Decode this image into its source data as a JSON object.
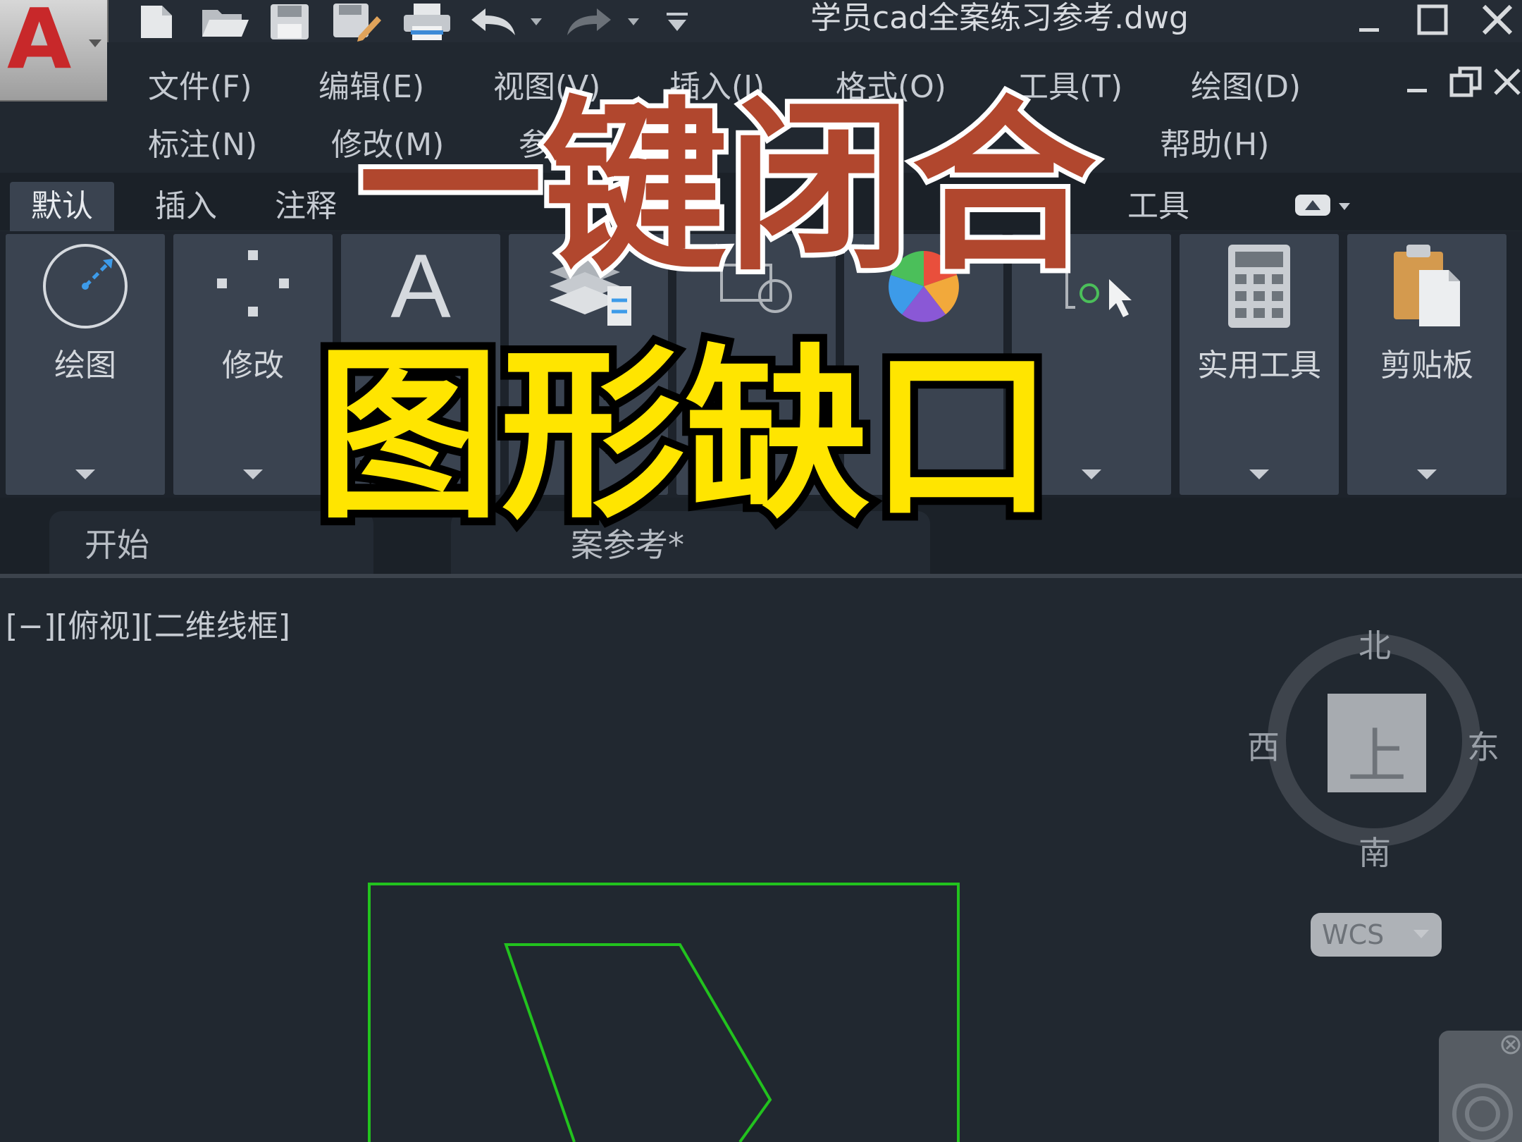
{
  "app": {
    "logo_letter": "A",
    "document_title": "学员cad全案练习参考.dwg"
  },
  "quick_access": [
    {
      "icon": "new-file-icon"
    },
    {
      "icon": "open-folder-icon"
    },
    {
      "icon": "save-icon"
    },
    {
      "icon": "save-as-icon"
    },
    {
      "icon": "print-icon"
    },
    {
      "icon": "undo-icon"
    },
    {
      "icon": "redo-icon"
    },
    {
      "icon": "customize-toolbar-icon"
    }
  ],
  "menu": {
    "row1": [
      "文件(F)",
      "编辑(E)",
      "视图(V)",
      "插入(I)",
      "格式(O)",
      "工具(T)",
      "绘图(D)"
    ],
    "row2": [
      "标注(N)",
      "修改(M)",
      "参",
      "帮助(H)"
    ]
  },
  "ribbon_tabs": [
    "默认",
    "插入",
    "注释",
    "工具"
  ],
  "ribbon_panels": [
    {
      "label": "绘图",
      "icon": "circle-draw-icon"
    },
    {
      "label": "修改",
      "icon": "modify-dots-icon"
    },
    {
      "label": "",
      "icon": "text-icon",
      "glyph": "A"
    },
    {
      "label": "",
      "icon": "layers-icon"
    },
    {
      "label": "",
      "icon": "block-icon"
    },
    {
      "label": "",
      "icon": "color-wheel-icon"
    },
    {
      "label": "",
      "icon": "select-cursor-icon"
    },
    {
      "label": "实用工具",
      "icon": "calculator-icon"
    },
    {
      "label": "剪贴板",
      "icon": "clipboard-icon"
    }
  ],
  "file_tabs": {
    "start": "开始",
    "file_partial": "案参考*"
  },
  "viewport": {
    "label": "[−][俯视][二维线框]"
  },
  "viewcube": {
    "north": "北",
    "south": "南",
    "east": "东",
    "west": "西",
    "face": "上",
    "wcs": "WCS"
  },
  "caption": {
    "line1": "一键闭合",
    "line2": "图形缺口"
  },
  "colors": {
    "background": "#212830",
    "panel": "#3a4350",
    "drawing_lines": "#22c21e",
    "caption_red": "#b1472e",
    "caption_yellow": "#ffe500"
  }
}
